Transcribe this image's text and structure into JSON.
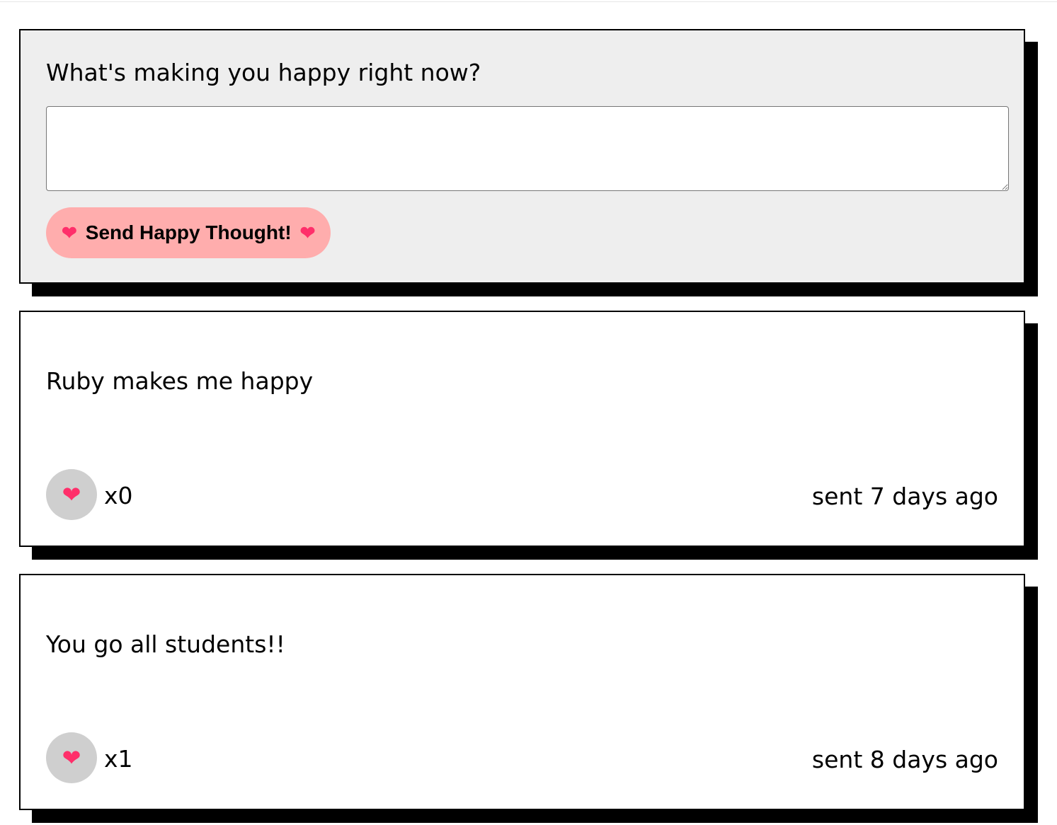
{
  "form": {
    "prompt": "What's making you happy right now?",
    "input_value": "",
    "send_button": {
      "label": "Send Happy Thought!",
      "icon_left": "❤",
      "icon_right": "❤"
    }
  },
  "thoughts": [
    {
      "message": "Ruby makes me happy",
      "like_icon": "❤",
      "likes_label": "x0",
      "sent_label": "sent 7 days ago"
    },
    {
      "message": "You go all students!!",
      "like_icon": "❤",
      "likes_label": "x1",
      "sent_label": "sent 8 days ago"
    }
  ],
  "colors": {
    "form_background": "#eeeeee",
    "button_background": "#ffadad",
    "like_button_background": "#cfcfcf",
    "heart": "#ff2f6a",
    "shadow": "#000000"
  }
}
